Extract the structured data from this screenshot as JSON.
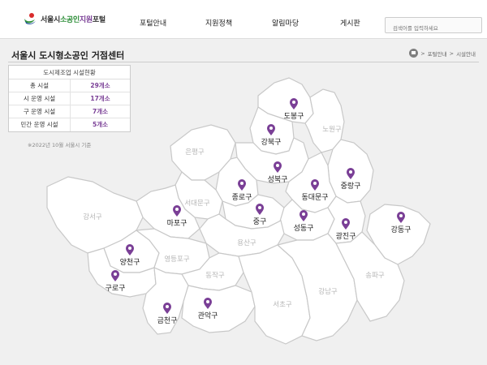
{
  "header": {
    "logo": {
      "part1": "서울시",
      "part2": "소공인",
      "part3": "지원",
      "part4": "포털"
    },
    "nav": [
      "포털안내",
      "지원정책",
      "알림마당",
      "게시판"
    ],
    "search_placeholder": "검색어를 입력하세요"
  },
  "page": {
    "title": "서울시 도시형소공인 거점센터",
    "breadcrumb": [
      "포털안내",
      "시설안내"
    ]
  },
  "stats": {
    "heading": "도시제조업 시설현황",
    "rows": [
      {
        "label": "총 시설",
        "value": "29개소"
      },
      {
        "label": "시 운영 시설",
        "value": "17개소"
      },
      {
        "label": "구 운영 시설",
        "value": "7개소"
      },
      {
        "label": "민간 운영 시설",
        "value": "5개소"
      }
    ],
    "note": "※2022년 10월 서울시 기준"
  },
  "map": {
    "marker_color": "#7a3f96",
    "inactive_label_color": "#b5b5b5",
    "active_label_color": "#222222",
    "districts_active": [
      {
        "name": "도봉구"
      },
      {
        "name": "강북구"
      },
      {
        "name": "성북구"
      },
      {
        "name": "종로구"
      },
      {
        "name": "동대문구"
      },
      {
        "name": "중랑구"
      },
      {
        "name": "마포구"
      },
      {
        "name": "중구"
      },
      {
        "name": "성동구"
      },
      {
        "name": "광진구"
      },
      {
        "name": "강동구"
      },
      {
        "name": "양천구"
      },
      {
        "name": "구로구"
      },
      {
        "name": "금천구"
      },
      {
        "name": "관악구"
      }
    ],
    "districts_inactive": [
      {
        "name": "노원구"
      },
      {
        "name": "은평구"
      },
      {
        "name": "서대문구"
      },
      {
        "name": "강서구"
      },
      {
        "name": "용산구"
      },
      {
        "name": "영등포구"
      },
      {
        "name": "동작구"
      },
      {
        "name": "서초구"
      },
      {
        "name": "강남구"
      },
      {
        "name": "송파구"
      }
    ]
  }
}
